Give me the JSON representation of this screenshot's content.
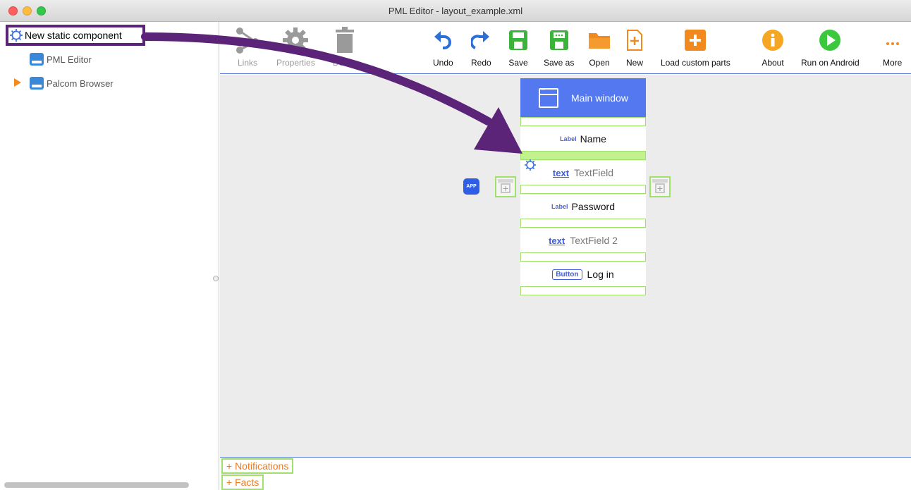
{
  "window": {
    "title": "PML Editor - layout_example.xml"
  },
  "sidebar": {
    "highlighted": {
      "label": "New static component",
      "icon": "gear-outline-icon"
    },
    "items": [
      {
        "label": "PML Editor",
        "icon": "device-icon"
      },
      {
        "label": "Palcom Browser",
        "icon": "device-icon",
        "expandable": true
      }
    ]
  },
  "toolbar": {
    "links": "Links",
    "properties": "Properties",
    "delete": "Delete",
    "undo": "Undo",
    "redo": "Redo",
    "save": "Save",
    "save_as": "Save as",
    "open": "Open",
    "new": "New",
    "load_custom_parts": "Load custom parts",
    "about": "About",
    "run_on_android": "Run on Android",
    "more": "More"
  },
  "canvas": {
    "app_badge": "APP",
    "main_window": "Main window",
    "components": [
      {
        "type": "Label",
        "value": "Name"
      },
      {
        "type": "text",
        "value": "TextField"
      },
      {
        "type": "Label",
        "value": "Password"
      },
      {
        "type": "text",
        "value": "TextField 2"
      },
      {
        "type": "Button",
        "value": "Log in"
      }
    ]
  },
  "bottom_panel": {
    "notifications": "+ Notifications",
    "facts": "+ Facts"
  },
  "colors": {
    "accent_purple": "#5b2479",
    "main_window_blue": "#5378f0",
    "slot_green": "#a0e06b",
    "orange": "#f07a1a"
  }
}
